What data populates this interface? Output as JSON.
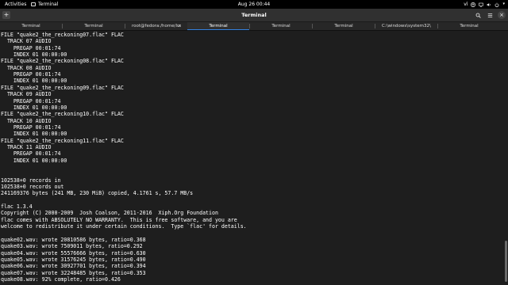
{
  "topbar": {
    "activities": "Activities",
    "app_name": "Terminal",
    "clock": "Aug 26  00:44",
    "lang": "vì"
  },
  "header": {
    "title": "Terminal",
    "new_tab_glyph": "+",
    "search_glyph": "⌕",
    "menu_glyph": "≡",
    "close_glyph": "×"
  },
  "tabs": [
    {
      "label": "Terminal"
    },
    {
      "label": "Terminal"
    },
    {
      "label": "root@fedora:/home/luc..."
    },
    {
      "label": "Terminal"
    },
    {
      "label": "Terminal"
    },
    {
      "label": "Terminal"
    },
    {
      "label": "C:\\windows\\system32\\c..."
    },
    {
      "label": "Terminal"
    }
  ],
  "tab_close_glyph": "×",
  "terminal": {
    "lines": [
      "FILE \"quake2_the_reckoning07.flac\" FLAC",
      "  TRACK 07 AUDIO",
      "    PREGAP 00:01:74",
      "    INDEX 01 00:00:00",
      "FILE \"quake2_the_reckoning08.flac\" FLAC",
      "  TRACK 08 AUDIO",
      "    PREGAP 00:01:74",
      "    INDEX 01 00:00:00",
      "FILE \"quake2_the_reckoning09.flac\" FLAC",
      "  TRACK 09 AUDIO",
      "    PREGAP 00:01:74",
      "    INDEX 01 00:00:00",
      "FILE \"quake2_the_reckoning10.flac\" FLAC",
      "  TRACK 10 AUDIO",
      "    PREGAP 00:01:74",
      "    INDEX 01 00:00:00",
      "FILE \"quake2_the_reckoning11.flac\" FLAC",
      "  TRACK 11 AUDIO",
      "    PREGAP 00:01:74",
      "    INDEX 01 00:00:00",
      "",
      "",
      "102538+0 records in",
      "102538+0 records out",
      "241169376 bytes (241 MB, 230 MiB) copied, 4.1761 s, 57.7 MB/s",
      "",
      "flac 1.3.4",
      "Copyright (C) 2000-2009  Josh Coalson, 2011-2016  Xiph.Org Foundation",
      "flac comes with ABSOLUTELY NO WARRANTY.  This is free software, and you are",
      "welcome to redistribute it under certain conditions.  Type `flac' for details.",
      "",
      "quake02.wav: wrote 20810586 bytes, ratio=0.368",
      "quake03.wav: wrote 7509011 bytes, ratio=0.292",
      "quake04.wav: wrote 55576666 bytes, ratio=0.630",
      "quake05.wav: wrote 31576245 bytes, ratio=0.490",
      "quake06.wav: wrote 30927701 bytes, ratio=0.394",
      "quake07.wav: wrote 32248485 bytes, ratio=0.353",
      "quake08.wav: 92% complete, ratio=0.426"
    ]
  }
}
